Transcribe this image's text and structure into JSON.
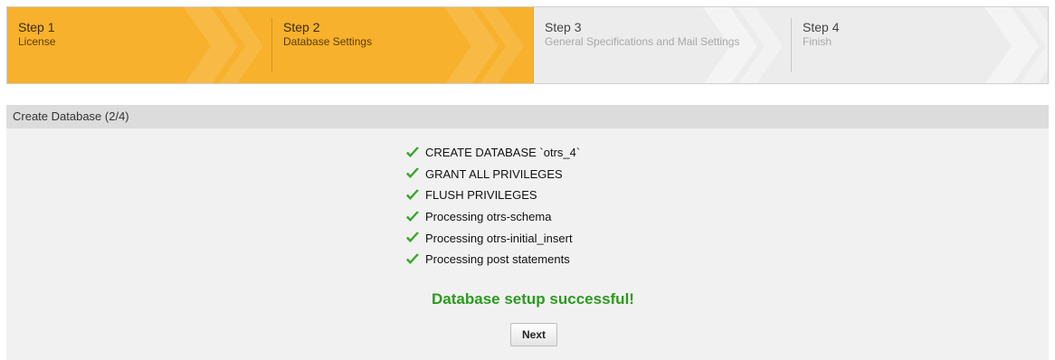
{
  "steps": [
    {
      "title": "Step 1",
      "desc": "License",
      "state": "done"
    },
    {
      "title": "Step 2",
      "desc": "Database Settings",
      "state": "current"
    },
    {
      "title": "Step 3",
      "desc": "General Specifications and Mail Settings",
      "state": "pending"
    },
    {
      "title": "Step 4",
      "desc": "Finish",
      "state": "pending"
    }
  ],
  "widget": {
    "title": "Create Database (2/4)",
    "items": [
      {
        "icon": "check-icon",
        "text": "CREATE DATABASE `otrs_4`"
      },
      {
        "icon": "check-icon",
        "text": "GRANT ALL PRIVILEGES"
      },
      {
        "icon": "check-icon",
        "text": "FLUSH PRIVILEGES"
      },
      {
        "icon": "check-icon",
        "text": "Processing otrs-schema"
      },
      {
        "icon": "check-icon",
        "text": "Processing otrs-initial_insert"
      },
      {
        "icon": "check-icon",
        "text": "Processing post statements"
      }
    ],
    "success_message": "Database setup successful!",
    "next_label": "Next"
  },
  "colors": {
    "active_step": "#f7b12c",
    "inactive_step": "#ececec",
    "success": "#2c9a1e",
    "check": "#3aa52d"
  }
}
